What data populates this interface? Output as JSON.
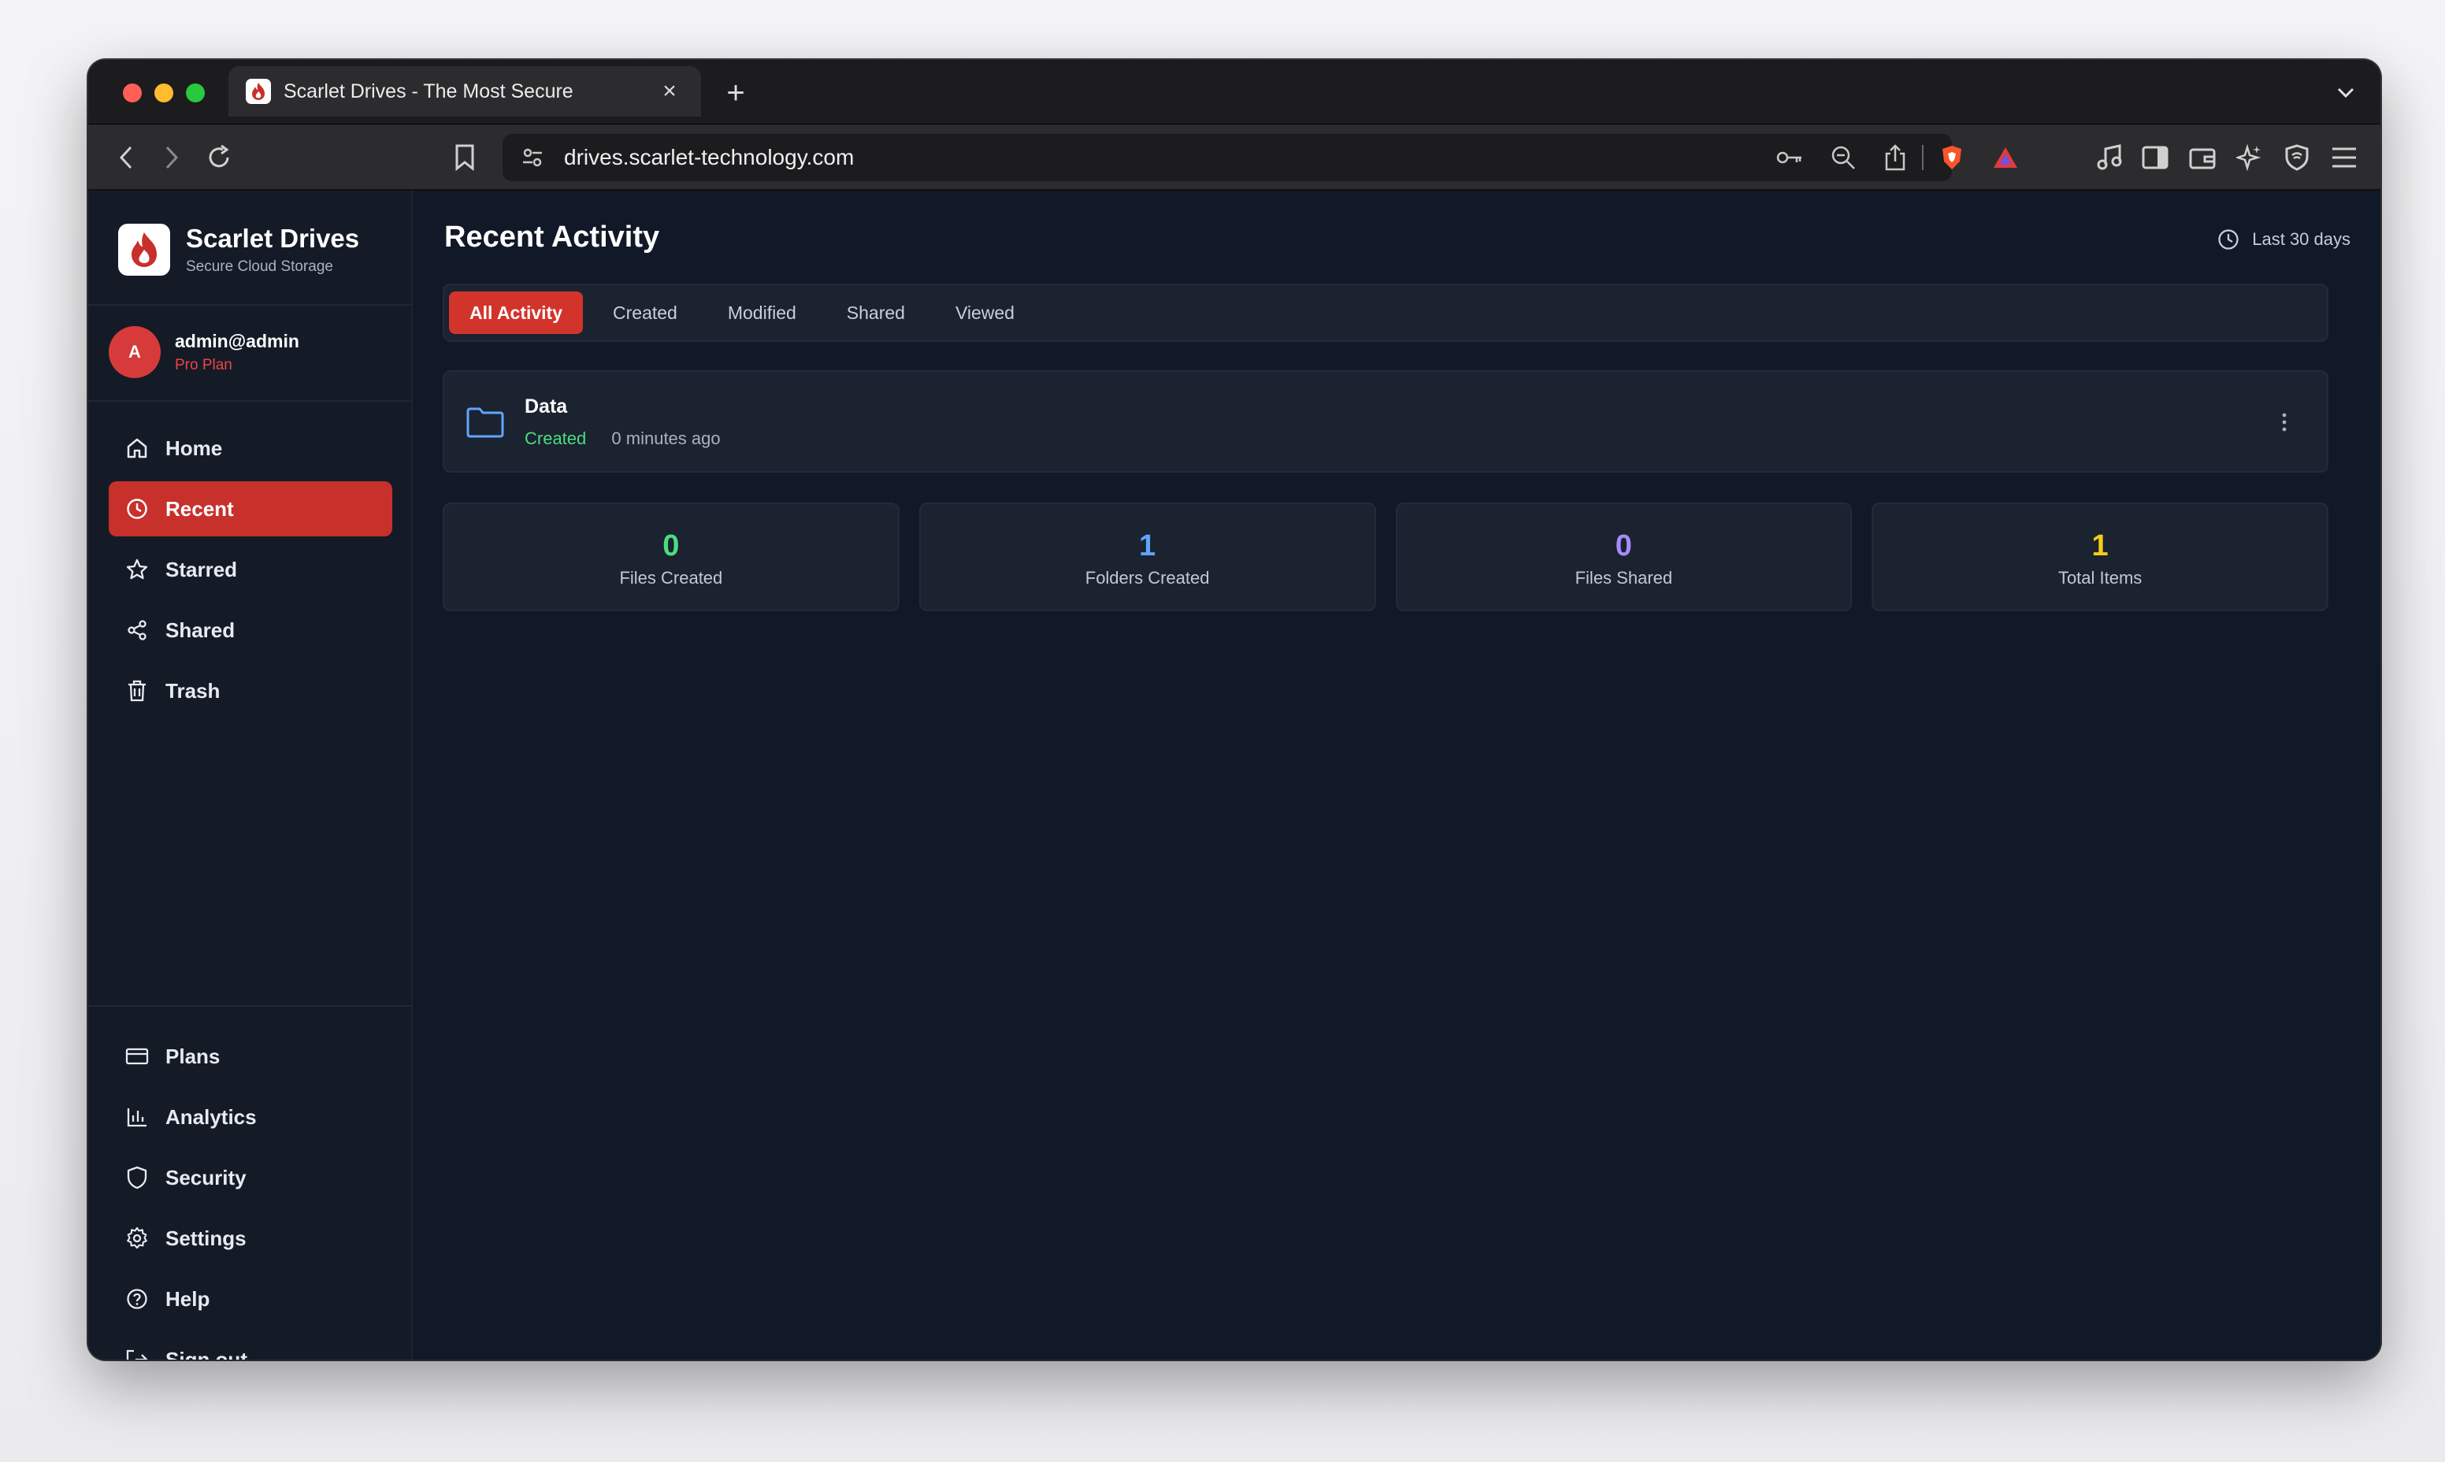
{
  "browser": {
    "tab_title": "Scarlet Drives - The Most Secure",
    "url": "drives.scarlet-technology.com"
  },
  "brand": {
    "name": "Scarlet Drives",
    "subtitle": "Secure Cloud Storage"
  },
  "user": {
    "initial": "A",
    "email": "admin@admin",
    "plan": "Pro Plan"
  },
  "nav_top": [
    {
      "label": "Home",
      "icon": "home-icon"
    },
    {
      "label": "Recent",
      "icon": "clock-icon",
      "active": true
    },
    {
      "label": "Starred",
      "icon": "star-icon"
    },
    {
      "label": "Shared",
      "icon": "share-icon"
    },
    {
      "label": "Trash",
      "icon": "trash-icon"
    }
  ],
  "nav_bottom": [
    {
      "label": "Plans",
      "icon": "card-icon"
    },
    {
      "label": "Analytics",
      "icon": "bar-chart-icon"
    },
    {
      "label": "Security",
      "icon": "shield-icon"
    },
    {
      "label": "Settings",
      "icon": "gear-icon"
    },
    {
      "label": "Help",
      "icon": "help-icon"
    },
    {
      "label": "Sign out",
      "icon": "sign-out-icon"
    }
  ],
  "main": {
    "title": "Recent Activity",
    "range": "Last 30 days",
    "filters": [
      "All Activity",
      "Created",
      "Modified",
      "Shared",
      "Viewed"
    ],
    "active_filter": "All Activity",
    "activity": [
      {
        "name": "Data",
        "action": "Created",
        "time": "0 minutes ago",
        "icon": "folder-icon"
      }
    ],
    "stats": [
      {
        "value": "0",
        "label": "Files Created",
        "color": "#4ade80"
      },
      {
        "value": "1",
        "label": "Folders Created",
        "color": "#60a5fa"
      },
      {
        "value": "0",
        "label": "Files Shared",
        "color": "#a78bfa"
      },
      {
        "value": "1",
        "label": "Total Items",
        "color": "#facc15"
      }
    ]
  },
  "colors": {
    "accent": "#c8302b",
    "sidebar_bg": "#141b27",
    "main_bg": "#111827",
    "card_bg": "#1b2230"
  }
}
